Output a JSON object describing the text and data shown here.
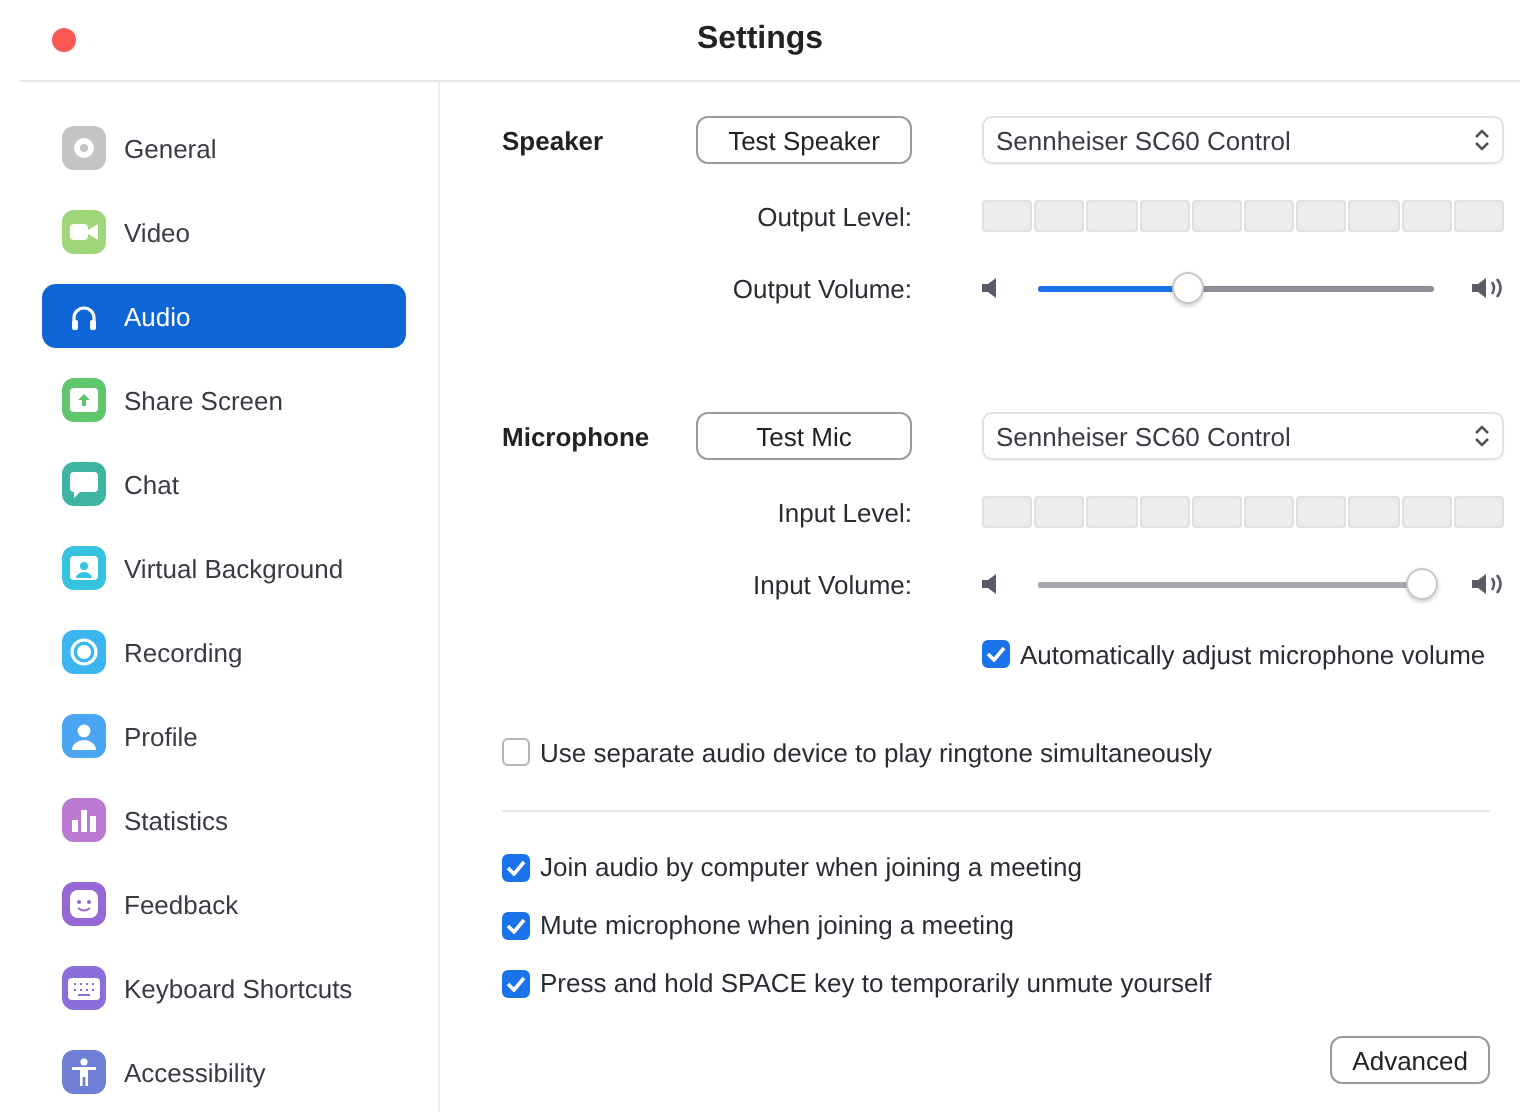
{
  "window": {
    "title": "Settings"
  },
  "sidebar": {
    "items": [
      {
        "label": "General",
        "color": "#c4c4c4",
        "selected": false
      },
      {
        "label": "Video",
        "color": "#9fd67a",
        "selected": false
      },
      {
        "label": "Audio",
        "color": "#0e66d6",
        "selected": true
      },
      {
        "label": "Share Screen",
        "color": "#5fc66d",
        "selected": false
      },
      {
        "label": "Chat",
        "color": "#3db5a2",
        "selected": false
      },
      {
        "label": "Virtual Background",
        "color": "#36c3e0",
        "selected": false
      },
      {
        "label": "Recording",
        "color": "#3cb6f0",
        "selected": false
      },
      {
        "label": "Profile",
        "color": "#4aa6f2",
        "selected": false
      },
      {
        "label": "Statistics",
        "color": "#bb7ad2",
        "selected": false
      },
      {
        "label": "Feedback",
        "color": "#9668d6",
        "selected": false
      },
      {
        "label": "Keyboard Shortcuts",
        "color": "#8a6fdc",
        "selected": false
      },
      {
        "label": "Accessibility",
        "color": "#6f7fd6",
        "selected": false
      }
    ]
  },
  "speaker": {
    "label": "Speaker",
    "test_button": "Test Speaker",
    "device": "Sennheiser SC60 Control",
    "level_label": "Output Level:",
    "volume_label": "Output Volume:",
    "volume": {
      "level": 0.38,
      "disabled": false
    }
  },
  "microphone": {
    "label": "Microphone",
    "test_button": "Test Mic",
    "device": "Sennheiser SC60 Control",
    "level_label": "Input Level:",
    "volume_label": "Input Volume:",
    "volume": {
      "level": 0.97,
      "disabled": true
    },
    "auto_adjust": {
      "label": "Automatically adjust microphone volume",
      "checked": true
    }
  },
  "separate_device": {
    "label": "Use separate audio device to play ringtone simultaneously",
    "checked": false
  },
  "options": [
    {
      "label": "Join audio by computer when joining a meeting",
      "checked": true
    },
    {
      "label": "Mute microphone when joining a meeting",
      "checked": true
    },
    {
      "label": "Press and hold SPACE key to temporarily unmute yourself",
      "checked": true
    }
  ],
  "advanced_button": "Advanced"
}
